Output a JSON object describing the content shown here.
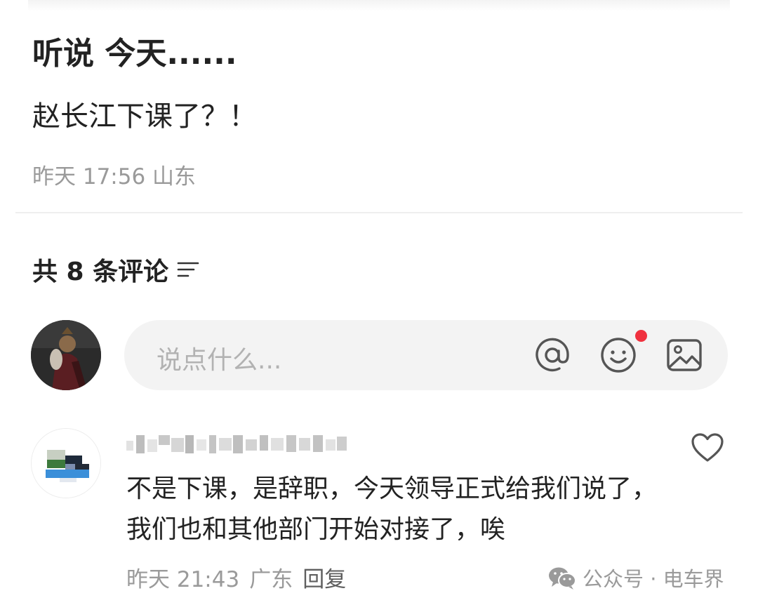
{
  "post": {
    "title": "听说 今天......",
    "body": "赵长江下课了？！",
    "meta": "昨天 17:56 山东"
  },
  "comments_section": {
    "count_label": "共 8 条评论",
    "input_placeholder": "说点什么..."
  },
  "comments": [
    {
      "text": "不是下课，是辞职，今天领导正式给我们说了，我们也和其他部门开始对接了，唉",
      "time": "昨天 21:43",
      "location": "广东",
      "reply_label": "回复"
    }
  ],
  "watermark": {
    "text": "公众号 · 电车界",
    "icon": "wechat-icon"
  },
  "colors": {
    "accent_dot": "#f0313e",
    "secondary_text": "#9a9a9a",
    "input_bg": "#f3f3f3"
  }
}
